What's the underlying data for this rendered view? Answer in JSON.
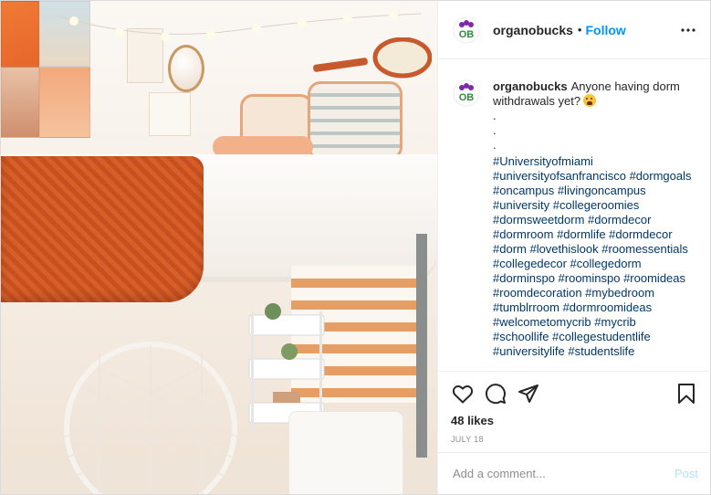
{
  "photo": {
    "description_icon": "dorm-room-photo"
  },
  "header": {
    "username": "organobucks",
    "separator": "•",
    "follow_label": "Follow",
    "more_icon": "more-horizontal-icon"
  },
  "avatar": {
    "letters": "OB",
    "accent": "#2e8b3c",
    "ring": "#7d2aa8"
  },
  "caption": {
    "username": "organobucks",
    "text": "Anyone having dorm withdrawals yet?",
    "emoji_icon": "astonished-face-emoji",
    "dots": [
      ".",
      ".",
      "."
    ],
    "hashtags": [
      "#Universityofmiami",
      "#universityofsanfrancisco #dormgoals",
      "#oncampus #livingoncampus",
      "#university #collegeroomies",
      "#dormsweetdorm #dormdecor",
      "#dormroom #dormlife #dormdecor",
      "#dorm #lovethislook #roomessentials",
      "#collegedecor #collegedorm",
      "#dorminspo #roominspo #roomideas",
      "#roomdecoration #mybedroom",
      "#tumblrroom #dormroomideas",
      "#welcometomycrib #mycrib",
      "#schoollife #collegestudentlife",
      "#universitylife #studentslife"
    ]
  },
  "actions": {
    "like_icon": "heart-icon",
    "comment_icon": "comment-icon",
    "share_icon": "share-icon",
    "save_icon": "bookmark-icon",
    "likes": "48 likes",
    "date": "JULY 18"
  },
  "comment": {
    "placeholder": "Add a comment...",
    "post_label": "Post"
  },
  "colors": {
    "link_blue": "#0095f6",
    "hashtag": "#00376b",
    "muted": "#8e8e8e",
    "post_disabled": "#b2dffc"
  }
}
